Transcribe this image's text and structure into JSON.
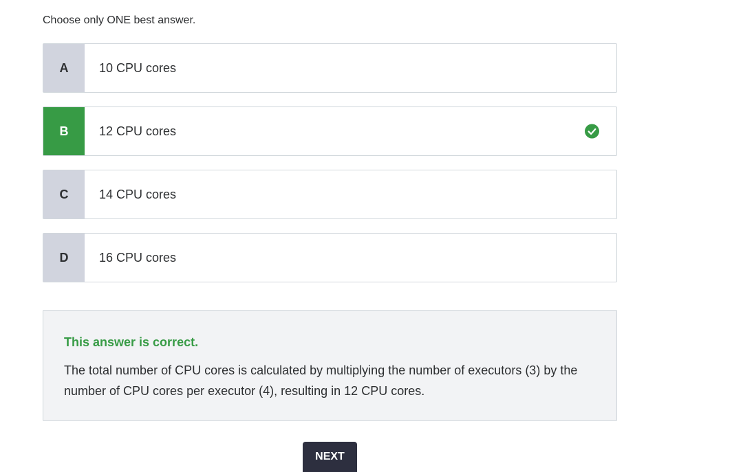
{
  "quiz": {
    "instruction": "Choose only ONE best answer.",
    "options": [
      {
        "letter": "A",
        "text": "10 CPU cores"
      },
      {
        "letter": "B",
        "text": "12 CPU cores"
      },
      {
        "letter": "C",
        "text": "14 CPU cores"
      },
      {
        "letter": "D",
        "text": "16 CPU cores"
      }
    ],
    "selected": "B",
    "correct_icon": "check-circle-icon"
  },
  "feedback": {
    "title": "This answer is correct.",
    "body": "The total number of CPU cores is calculated by multiplying the number of executors (3) by the number of CPU cores per executor (4), resulting in 12 CPU cores."
  },
  "actions": {
    "next_label": "NEXT"
  },
  "colors": {
    "correct": "#379b45",
    "letter_bg": "#d1d4de",
    "button_bg": "#2d2f3f",
    "feedback_bg": "#f2f3f5"
  }
}
